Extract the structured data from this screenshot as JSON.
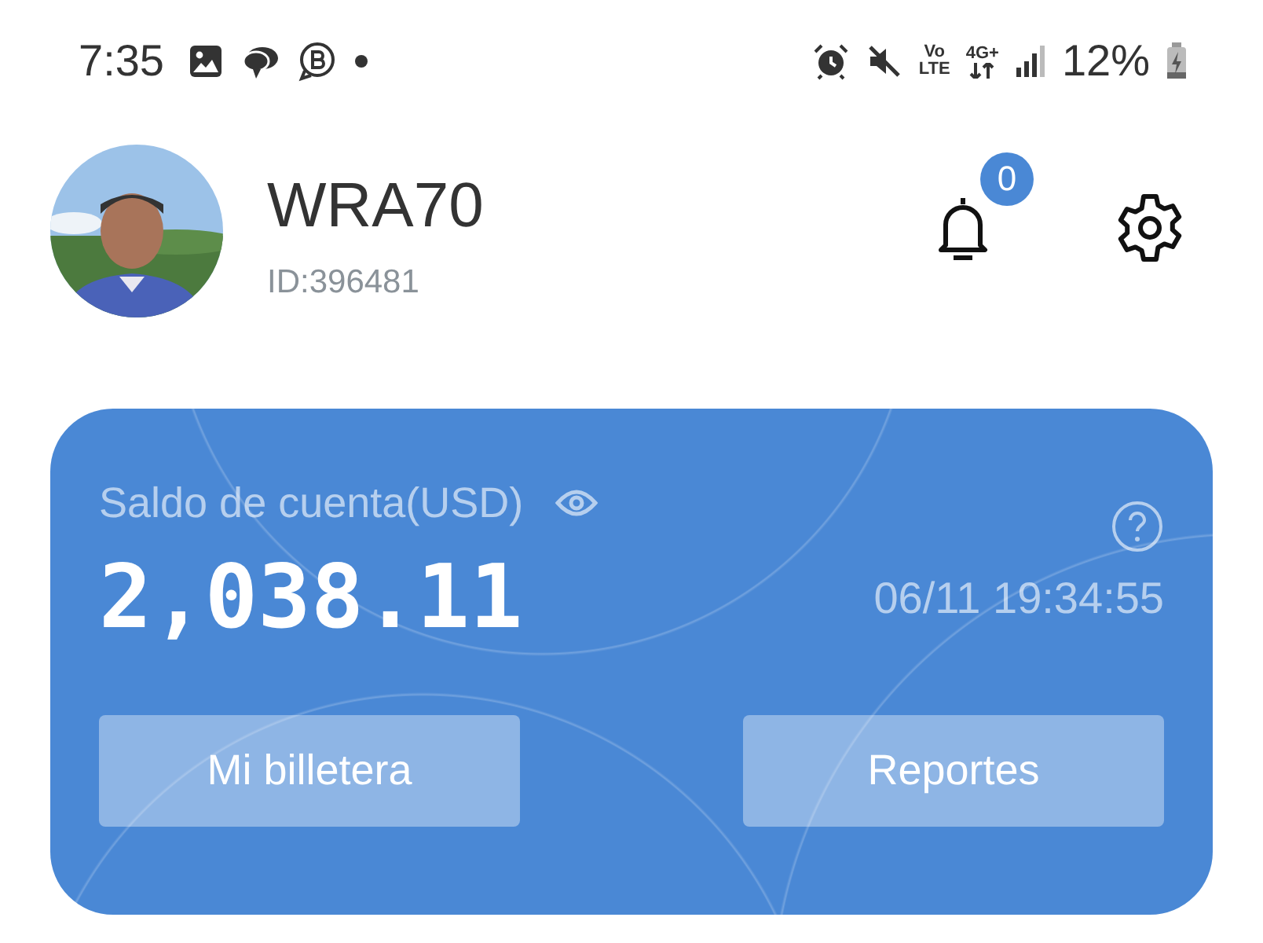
{
  "status_bar": {
    "time": "7:35",
    "network_labels": [
      "Vo",
      "LTE",
      "4G+"
    ],
    "battery": "12%"
  },
  "profile": {
    "name": "WRA70",
    "id": "ID:396481"
  },
  "notifications": {
    "count": "0"
  },
  "account_card": {
    "label": "Saldo de cuenta(USD)",
    "balance": "2,038.11",
    "timestamp": "06/11 19:34:55",
    "buttons": [
      {
        "label": "Mi billetera"
      },
      {
        "label": "Reportes"
      }
    ]
  }
}
